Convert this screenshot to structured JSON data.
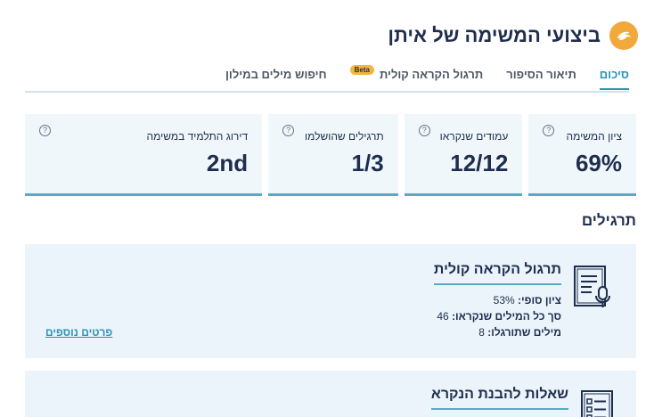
{
  "header": {
    "title": "ביצועי המשימה של איתן",
    "logo_icon": "dolphin-icon",
    "accent_color": "#f2a93b"
  },
  "tabs": [
    {
      "label": "סיכום",
      "active": true
    },
    {
      "label": "תיאור הסיפור",
      "active": false
    },
    {
      "label": "תרגול הקראה קולית",
      "active": false,
      "badge": "Beta"
    },
    {
      "label": "חיפוש מילים במילון",
      "active": false
    }
  ],
  "stats": [
    {
      "label": "ציון המשימה",
      "value": "69%"
    },
    {
      "label": "עמודים שנקראו",
      "value": "12/12"
    },
    {
      "label": "תרגילים שהושלמו",
      "value": "1/3"
    },
    {
      "label": "דירוג התלמיד במשימה",
      "value": "2nd"
    }
  ],
  "help_glyph": "?",
  "exercises_section": {
    "title": "תרגילים"
  },
  "exercises": [
    {
      "title": "תרגול הקראה קולית",
      "icon": "reading-mic-icon",
      "lines": [
        {
          "label": "ציון סופי:",
          "value": "53%"
        },
        {
          "label": "סך כל המילים שנקראו:",
          "value": "46"
        },
        {
          "label": "מילים שתורגלו:",
          "value": "8"
        }
      ],
      "more_link": "פרטים נוספים"
    },
    {
      "title": "שאלות להבנת הנקרא",
      "icon": "checklist-icon"
    }
  ],
  "colors": {
    "primary": "#2a93b6",
    "card_bg": "#f0f7fb",
    "panel_bg": "#eaf4fa",
    "text": "#1f2d4e"
  }
}
